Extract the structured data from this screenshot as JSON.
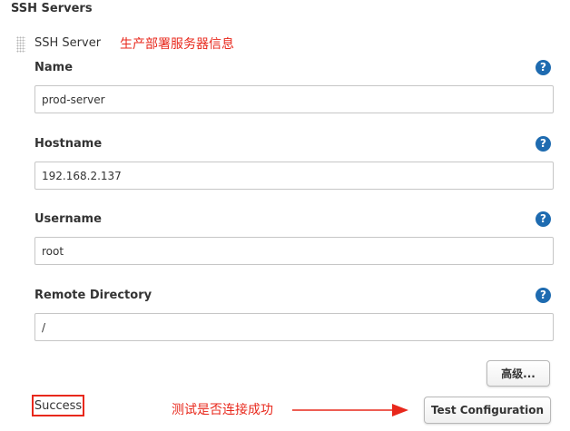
{
  "section": {
    "title": "SSH Servers"
  },
  "server": {
    "label": "SSH Server",
    "annotation": "生产部署服务器信息"
  },
  "fields": [
    {
      "label": "Name",
      "value": "prod-server"
    },
    {
      "label": "Hostname",
      "value": "192.168.2.137"
    },
    {
      "label": "Username",
      "value": "root"
    },
    {
      "label": "Remote Directory",
      "value": "/"
    }
  ],
  "help_glyph": "?",
  "buttons": {
    "advanced": "高级...",
    "test": "Test Configuration"
  },
  "status": {
    "text": "Success"
  },
  "annotation_test": "测试是否连接成功",
  "colors": {
    "annotation": "#e8281c",
    "help_icon": "#1e6bb0"
  },
  "icons": {
    "drag_handle": "drag-handle-icon",
    "help": "help-icon",
    "arrow": "arrow-right-icon"
  }
}
